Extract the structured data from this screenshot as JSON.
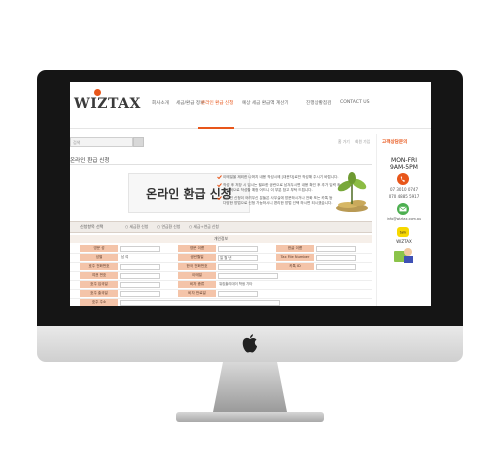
{
  "brand": {
    "logo_text": "WIZTAX",
    "accent": "#e8561a"
  },
  "nav": {
    "items": [
      {
        "label": "회사소개"
      },
      {
        "label": "세금/환급 정보"
      },
      {
        "label": "온라인 환급 신청"
      },
      {
        "label": "예상 세금 환급액 계산기"
      },
      {
        "label": "진행상황점검"
      },
      {
        "label": "CONTACT US"
      }
    ],
    "active_index": 2
  },
  "search": {
    "placeholder": "검색"
  },
  "breadcrumb": {
    "home": "홈 가기",
    "current": "회원 가입"
  },
  "page": {
    "title": "온라인 환급 신청",
    "hero_title": "온라인 환급 신청"
  },
  "notes": [
    "이메일을 제외한 나머지 내용 작성시에 [대문자]로만 작성해 주시기 바랍니다.",
    "작성 후 저장 시 입시는 필요한 공란으로 남겨두시면 내용 확인 후 추가 입력 후",
    "개별적으로 작성할 예정 어드니 이 부분 참고 부탁 드립니다.",
    "온라인 신청이 어려우신 분들은 사무실에 방문하시거나 전화 또는 카톡 등",
    "다양한 방법으로 신청 가능하시니 편리한 방법 선택 하시면 되시겠습니다."
  ],
  "form": {
    "select_label": "신청항목 선택",
    "options": [
      "세금환 신청",
      "연금환 신청",
      "세금+연금 신청"
    ],
    "section_title": "개인정보",
    "rows": [
      [
        {
          "label": "영문 성",
          "value": ""
        },
        {
          "label": "영문 이름",
          "value": ""
        },
        {
          "label": "한글 이름",
          "value": ""
        }
      ],
      [
        {
          "label": "성별",
          "value": "남 여"
        },
        {
          "label": "생년월일",
          "value": "일  월  년"
        },
        {
          "label": "Tax File Number",
          "value": ""
        }
      ],
      [
        {
          "label": "호주 전화번호",
          "value": ""
        },
        {
          "label": "한국 전화번호",
          "value": ""
        },
        {
          "label": "카톡 ID",
          "value": ""
        }
      ],
      [
        {
          "label": "여권 번호",
          "value": ""
        },
        {
          "label": "이메일",
          "value": ""
        }
      ],
      [
        {
          "label": "호주 입국일",
          "value": ""
        },
        {
          "label": "비자 종류",
          "value": "워킹홀리데이 학생 기타"
        }
      ],
      [
        {
          "label": "호주 출국일",
          "value": ""
        },
        {
          "label": "비자 만료일",
          "value": ""
        }
      ],
      [
        {
          "label": "호주 주소",
          "value": ""
        }
      ]
    ]
  },
  "sidebar": {
    "title": "고객상담문의",
    "hours_days": "MON-FRI",
    "hours_time": "9AM-5PM",
    "phone1": "07 3010 0747",
    "phone2": "070 4885 5917",
    "email": "info@wiztax.com.au",
    "kakao_id": "WIZTAX"
  }
}
